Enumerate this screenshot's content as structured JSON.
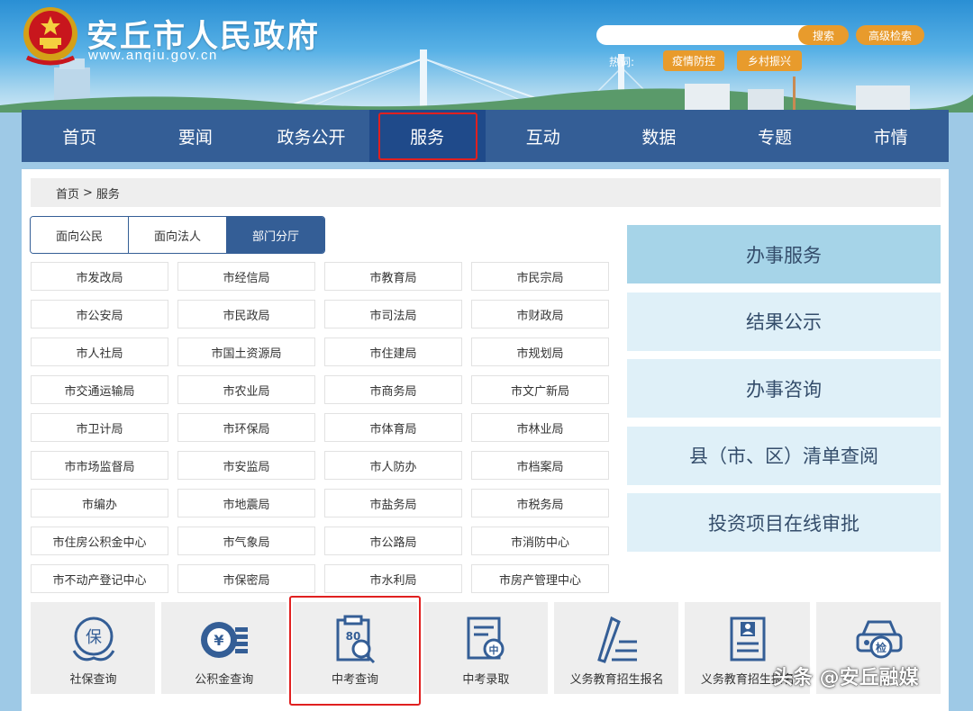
{
  "header": {
    "site_title": "安丘市人民政府",
    "site_url": "www.anqiu.gov.cn",
    "search": {
      "placeholder": "",
      "button_label": "搜索"
    },
    "advanced_search_label": "高级检索",
    "hot_label": "热词:",
    "hot_tags": [
      "疫情防控",
      "乡村振兴"
    ]
  },
  "nav": {
    "items": [
      "首页",
      "要闻",
      "政务公开",
      "服务",
      "互动",
      "数据",
      "专题",
      "市情"
    ],
    "active": "服务"
  },
  "breadcrumb": {
    "home": "首页",
    "separator": ">",
    "current": "服务"
  },
  "tabs": {
    "items": [
      "面向公民",
      "面向法人",
      "部门分厅"
    ],
    "active": "部门分厅"
  },
  "departments": [
    "市发改局",
    "市经信局",
    "市教育局",
    "市民宗局",
    "市公安局",
    "市民政局",
    "市司法局",
    "市财政局",
    "市人社局",
    "市国土资源局",
    "市住建局",
    "市规划局",
    "市交通运输局",
    "市农业局",
    "市商务局",
    "市文广新局",
    "市卫计局",
    "市环保局",
    "市体育局",
    "市林业局",
    "市市场监督局",
    "市安监局",
    "市人防办",
    "市档案局",
    "市编办",
    "市地震局",
    "市盐务局",
    "市税务局",
    "市住房公积金中心",
    "市气象局",
    "市公路局",
    "市消防中心",
    "市不动产登记中心",
    "市保密局",
    "市水利局",
    "市房产管理中心"
  ],
  "side_menu": {
    "items": [
      "办事服务",
      "结果公示",
      "办事咨询",
      "县（市、区）清单查阅",
      "投资项目在线审批"
    ],
    "active": "办事服务"
  },
  "quick_links": [
    {
      "label": "社保查询",
      "icon": "social-security-icon"
    },
    {
      "label": "公积金查询",
      "icon": "provident-fund-icon"
    },
    {
      "label": "中考查询",
      "icon": "exam-score-search-icon"
    },
    {
      "label": "中考录取",
      "icon": "admission-document-icon"
    },
    {
      "label": "义务教育招生报名",
      "icon": "pen-registration-icon"
    },
    {
      "label": "义务教育招生报名",
      "icon": "student-form-icon"
    },
    {
      "label": "",
      "icon": "vehicle-inspection-icon"
    }
  ],
  "watermark": "头条 @安丘融媒",
  "colors": {
    "nav_bg": "#345e96",
    "nav_active": "#1f4a8a",
    "accent_orange": "#e89b2c",
    "side_active": "#a6d4e8",
    "side_item": "#dff0f8",
    "highlight": "#e02020"
  }
}
